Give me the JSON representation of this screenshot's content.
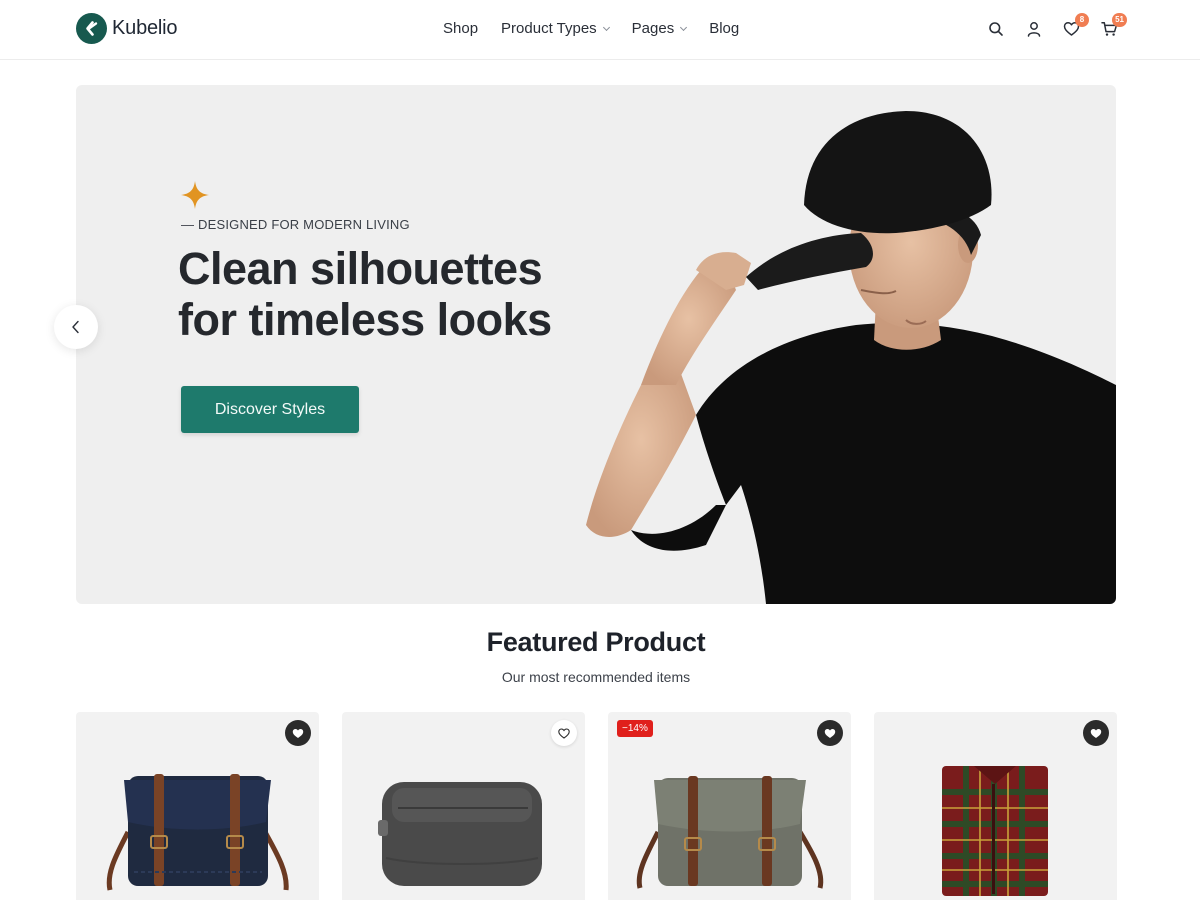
{
  "brand": {
    "name": "Kubelio",
    "accent": "#17594f"
  },
  "nav": {
    "items": [
      {
        "label": "Shop",
        "has_dropdown": false
      },
      {
        "label": "Product Types",
        "has_dropdown": true
      },
      {
        "label": "Pages",
        "has_dropdown": true
      },
      {
        "label": "Blog",
        "has_dropdown": false
      }
    ]
  },
  "header_icons": {
    "search": "search-icon",
    "account": "user-icon",
    "wishlist": {
      "icon": "heart-icon",
      "count": "8"
    },
    "cart": {
      "icon": "cart-icon",
      "count": "51"
    },
    "badge_color": "#f07d52"
  },
  "hero": {
    "eyebrow": "— DESIGNED FOR MODERN LIVING",
    "title_line1": "Clean silhouettes",
    "title_line2": "for timeless looks",
    "cta_label": "Discover Styles",
    "cta_color": "#1e7a6c",
    "star_color": "#e19422",
    "prev_icon": "chevron-left-icon"
  },
  "featured": {
    "title": "Featured Product",
    "subtitle": "Our most recommended items",
    "products": [
      {
        "image": "navy-messenger-bag",
        "wishlist_style": "dark",
        "sale": ""
      },
      {
        "image": "grey-pouch",
        "wishlist_style": "light",
        "sale": ""
      },
      {
        "image": "olive-messenger-bag",
        "wishlist_style": "dark",
        "sale": "−14%"
      },
      {
        "image": "plaid-flannel-shirt",
        "wishlist_style": "dark",
        "sale": ""
      }
    ]
  }
}
